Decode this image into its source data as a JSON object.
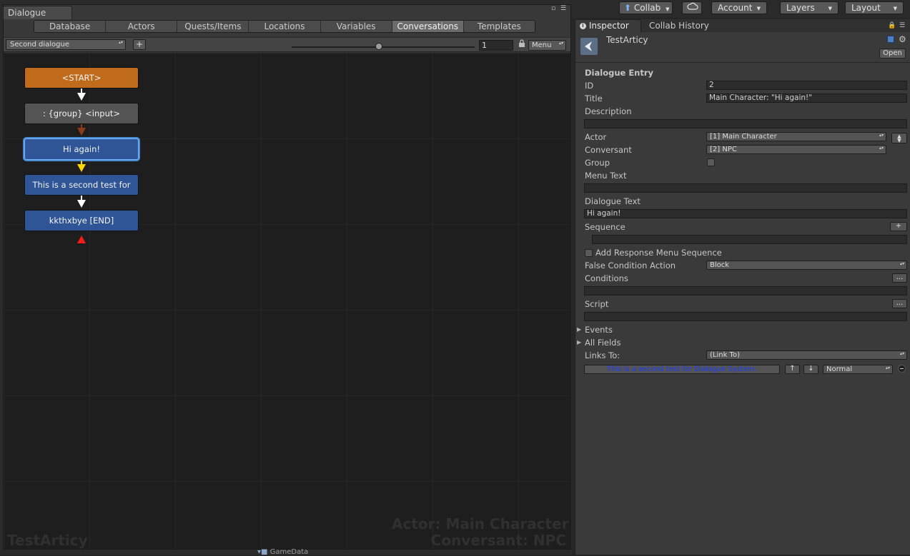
{
  "dialogue_window": {
    "tab_title": "Dialogue",
    "tabs": [
      {
        "label": "Database",
        "active": false
      },
      {
        "label": "Actors",
        "active": false
      },
      {
        "label": "Quests/Items",
        "active": false
      },
      {
        "label": "Locations",
        "active": false
      },
      {
        "label": "Variables",
        "active": false
      },
      {
        "label": "Conversations",
        "active": true
      },
      {
        "label": "Templates",
        "active": false
      }
    ],
    "toolbar": {
      "conversation": "Second dialogue",
      "add_label": "+",
      "zoom_value": "1",
      "menu_label": "Menu"
    },
    "nodes": {
      "start": "<START>",
      "group": ": {group} <input>",
      "selected": "Hi again!",
      "second": "This is a second test for",
      "end": "kkthxbye [END]"
    },
    "watermark": {
      "database": "TestArticy",
      "actor": "Actor: Main Character",
      "conversant": "Conversant: NPC"
    },
    "bottom_tab": "GameData"
  },
  "topbar": {
    "collab": "Collab",
    "account": "Account",
    "layers": "Layers",
    "layout": "Layout"
  },
  "inspector": {
    "tab_inspector": "Inspector",
    "tab_collab_history": "Collab History",
    "object_name": "TestArticy",
    "open_label": "Open",
    "section_title": "Dialogue Entry",
    "labels": {
      "id": "ID",
      "title": "Title",
      "description": "Description",
      "actor": "Actor",
      "conversant": "Conversant",
      "group": "Group",
      "menu_text": "Menu Text",
      "dialogue_text": "Dialogue Text",
      "sequence": "Sequence",
      "add_response_menu_sequence": "Add Response Menu Sequence",
      "false_condition_action": "False Condition Action",
      "conditions": "Conditions",
      "script": "Script",
      "events": "Events",
      "all_fields": "All Fields",
      "links_to": "Links To:"
    },
    "values": {
      "id": "2",
      "title": "Main Character: \"Hi again!\"",
      "description": "",
      "actor": "[1] Main Character",
      "conversant": "[2] NPC",
      "menu_text": "",
      "dialogue_text": "Hi again!",
      "sequence": "",
      "false_condition_action": "Block",
      "conditions": "",
      "script": "",
      "links_to": "(Link To)",
      "link_target": "This is a second test for Dialogue System.",
      "link_priority": "Normal"
    },
    "buttons": {
      "ellipsis": "...",
      "plus": "+",
      "up": "↑",
      "down": "↓"
    }
  },
  "colors": {
    "start_node": "#c06b1c",
    "dialogue_node": "#2f5596",
    "group_node": "#545454",
    "link_text": "#1a3cff"
  }
}
